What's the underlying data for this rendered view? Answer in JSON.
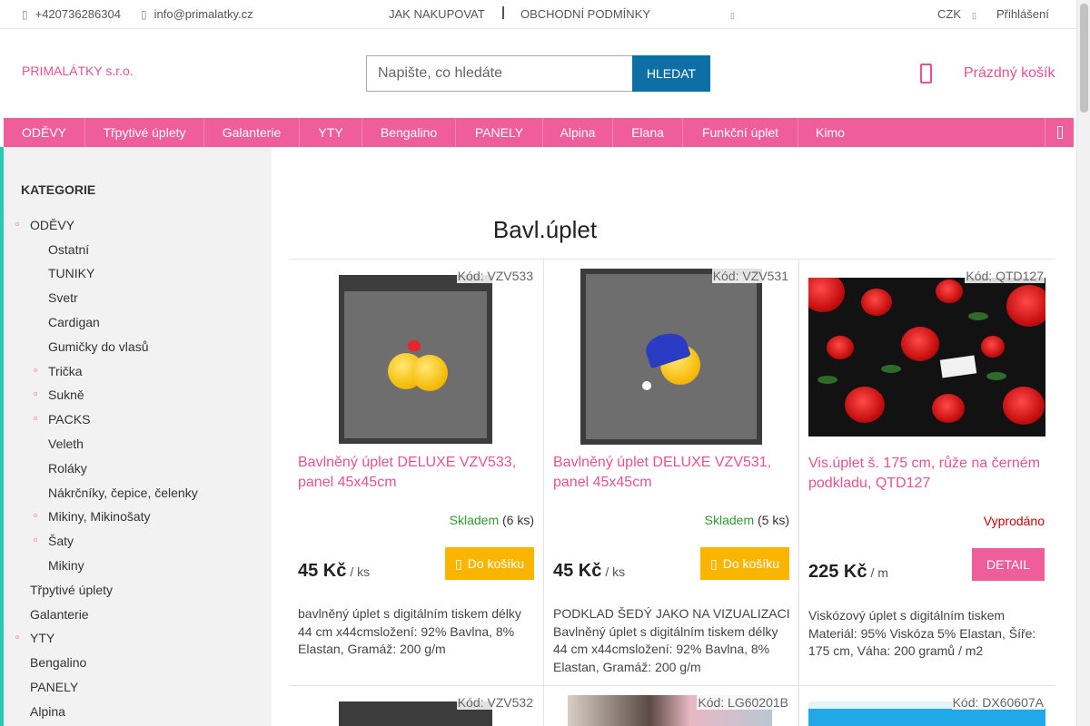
{
  "topbar": {
    "phone": "+420736286304",
    "email": "info@primalatky.cz",
    "how_to_buy": "JAK NAKUPOVAT",
    "terms": "OBCHODNÍ PODMÍNKY",
    "currency": "CZK",
    "login": "Přihlášení"
  },
  "header": {
    "logo": "PRIMALÁTKY s.r.o.",
    "search_placeholder": "Napište, co hledáte",
    "search_button": "HLEDAT",
    "cart": "Prázdný košík"
  },
  "nav": [
    "ODĚVY",
    "Třpytivé úplety",
    "Galanterie",
    "YTY",
    "Bengalino",
    "PANELY",
    "Alpina",
    "Elana",
    "Funkční úplet",
    "Kimo"
  ],
  "sidebar": {
    "title": "KATEGORIE",
    "items": [
      {
        "label": "ODĚVY",
        "level": 0,
        "bullet": true
      },
      {
        "label": "Ostatní",
        "level": 1,
        "bullet": false
      },
      {
        "label": "TUNIKY",
        "level": 1,
        "bullet": false
      },
      {
        "label": "Svetr",
        "level": 1,
        "bullet": false
      },
      {
        "label": "Cardigan",
        "level": 1,
        "bullet": false
      },
      {
        "label": "Gumičky do vlasů",
        "level": 1,
        "bullet": false
      },
      {
        "label": "Trička",
        "level": 1,
        "bullet": true
      },
      {
        "label": "Sukně",
        "level": 1,
        "bullet": true
      },
      {
        "label": "PACKS",
        "level": 1,
        "bullet": true
      },
      {
        "label": "Veleth",
        "level": 1,
        "bullet": false
      },
      {
        "label": "Roláky",
        "level": 1,
        "bullet": false
      },
      {
        "label": "Nákrčníky, čepice, čelenky",
        "level": 1,
        "bullet": false
      },
      {
        "label": "Mikiny, Mikinošaty",
        "level": 1,
        "bullet": true
      },
      {
        "label": "Šaty",
        "level": 1,
        "bullet": true
      },
      {
        "label": "Mikiny",
        "level": 1,
        "bullet": false
      },
      {
        "label": "Třpytivé úplety",
        "level": 0,
        "bullet": false
      },
      {
        "label": "Galanterie",
        "level": 0,
        "bullet": false
      },
      {
        "label": "YTY",
        "level": 0,
        "bullet": true
      },
      {
        "label": "Bengalino",
        "level": 0,
        "bullet": false
      },
      {
        "label": "PANELY",
        "level": 0,
        "bullet": false
      },
      {
        "label": "Alpina",
        "level": 0,
        "bullet": false
      }
    ]
  },
  "main": {
    "title": "Bavl.úplet",
    "products": [
      {
        "code": "Kód: VZV533",
        "name": "Bavlněný úplet DELUXE VZV533, panel 45x45cm",
        "stock_label": "Skladem",
        "stock_count": "(6 ks)",
        "price": "45 Kč",
        "unit": "/ ks",
        "button": "Do košíku",
        "description": "bavlněný úplet s digitálním tiskem délky 44 cm x44cmsložení: 92% Bavlna, 8% Elastan, Gramáž: 200 g/m"
      },
      {
        "code": "Kód: VZV531",
        "name": "Bavlněný úplet DELUXE VZV531, panel 45x45cm",
        "stock_label": "Skladem",
        "stock_count": "(5 ks)",
        "price": "45 Kč",
        "unit": "/ ks",
        "button": "Do košíku",
        "description": "PODKLAD ŠEDÝ JAKO NA VIZUALIZACI  Bavlněný úplet s digitálním tiskem délky 44 cm x44cmsložení: 92% Bavlna, 8% Elastan, Gramáž: 200 g/m"
      },
      {
        "code": "Kód: QTD127",
        "name": "Vis.úplet š. 175 cm, růže na černém podkladu, QTD127",
        "stock_label": "Vyprodáno",
        "price": "225 Kč",
        "unit": "/ m",
        "button": "DETAIL",
        "description": "Viskózový úplet s digitálním tiskem Materiál: 95% Viskóza 5% Elastan,  Šíře: 175 cm,  Váha: 200 gramů / m2"
      }
    ],
    "next_row_codes": [
      "Kód: VZV532",
      "Kód: LG60201B",
      "Kód: DX60607A"
    ]
  },
  "colors": {
    "brand_pink": "#ef5d9b",
    "link_pink": "#e9528c",
    "search_blue": "#0e6fa7",
    "buy_yellow": "#f9b500",
    "in_stock_green": "#2e9b2e",
    "sold_out_red": "#cc0000",
    "accent_teal": "#27c9b5"
  },
  "icons": {
    "phone": "phone-icon",
    "email": "email-icon",
    "cart": "cart-icon",
    "menu": "menu-icon",
    "buy": "cart-icon"
  }
}
